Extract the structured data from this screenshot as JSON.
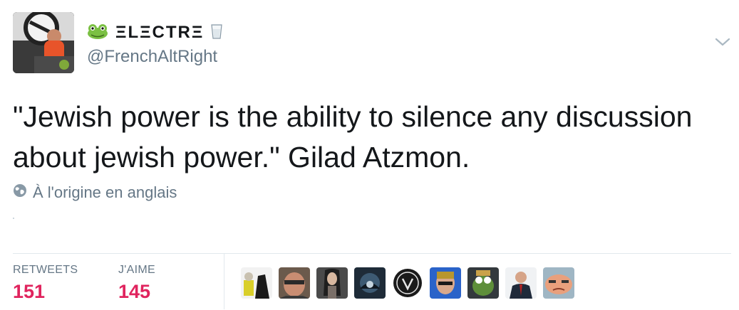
{
  "user": {
    "display_name": "ΞLΞCTRΞ",
    "handle": "@FrenchAltRight"
  },
  "tweet": {
    "text": "\"Jewish power is the ability to silence any discussion about jewish power.\" Gilad Atzmon.",
    "translation_note": "À l'origine en anglais"
  },
  "stats": {
    "retweets_label": "RETWEETS",
    "retweets_count": "151",
    "likes_label": "J'AIME",
    "likes_count": "145"
  },
  "icons": {
    "emoji_before_name": "frog-face-icon",
    "emoji_after_name": "cup-icon",
    "globe": "globe-icon",
    "menu": "chevron-down-icon"
  },
  "colors": {
    "like_count": "#e0245e",
    "muted_text": "#657786",
    "border": "#e1e8ed"
  },
  "liked_by_avatars": [
    {
      "name": "avatar-1"
    },
    {
      "name": "avatar-2"
    },
    {
      "name": "avatar-3"
    },
    {
      "name": "avatar-4"
    },
    {
      "name": "avatar-5"
    },
    {
      "name": "avatar-6"
    },
    {
      "name": "avatar-7"
    },
    {
      "name": "avatar-8"
    },
    {
      "name": "avatar-9"
    }
  ]
}
